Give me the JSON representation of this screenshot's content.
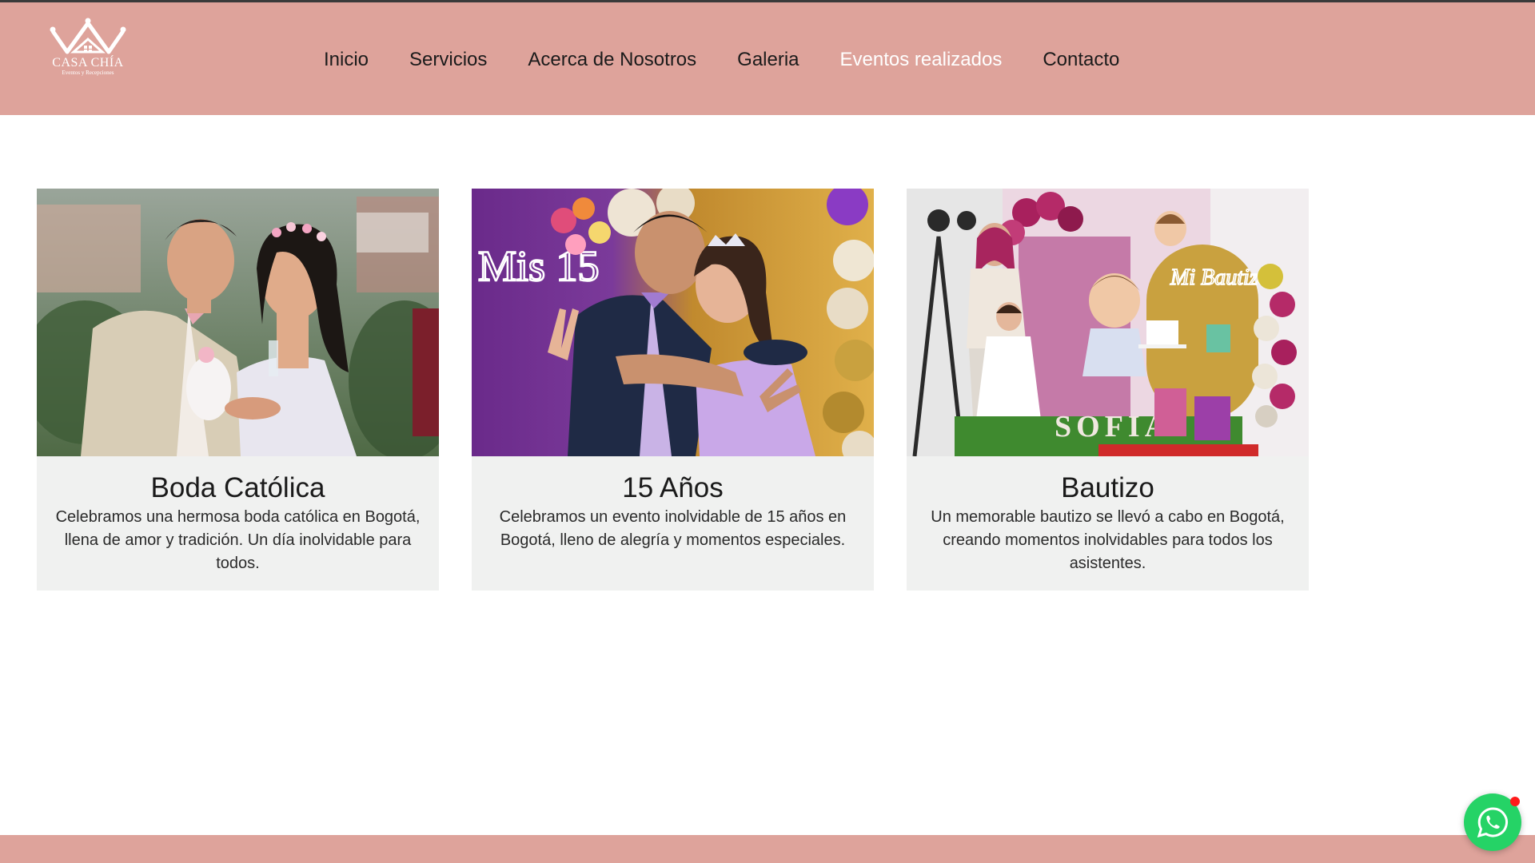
{
  "logo": {
    "name": "CASA CHÍA",
    "subtitle": "Eventos y Recepciones"
  },
  "nav": {
    "items": [
      {
        "label": "Inicio"
      },
      {
        "label": "Servicios"
      },
      {
        "label": "Acerca de Nosotros"
      },
      {
        "label": "Galeria"
      },
      {
        "label": "Eventos realizados"
      },
      {
        "label": "Contacto"
      }
    ],
    "active_index": 4
  },
  "cards": [
    {
      "title": "Boda Católica",
      "description": "Celebramos una hermosa boda católica en Bogotá, llena de amor y tradición. Un día inolvidable para todos.",
      "image": "wedding-couple-photo"
    },
    {
      "title": "15 Años",
      "description": "Celebramos un evento inolvidable de 15 años en Bogotá, lleno de alegría y momentos especiales.",
      "image": "quinceanera-photo",
      "neon_text": "Mis 15"
    },
    {
      "title": "Bautizo",
      "description": "Un memorable bautizo se llevó a cabo en Bogotá, creando momentos inolvidables para todos los asistentes.",
      "image": "baptism-photo",
      "neon_text": "Mi Bautizo",
      "banner_text": "SOFIA"
    }
  ],
  "colors": {
    "header_bg": "#dea39b",
    "active_nav": "#ffffff",
    "card_bg": "#f0f1f0",
    "whatsapp": "#25d366"
  },
  "whatsapp": {
    "icon": "whatsapp-icon"
  }
}
